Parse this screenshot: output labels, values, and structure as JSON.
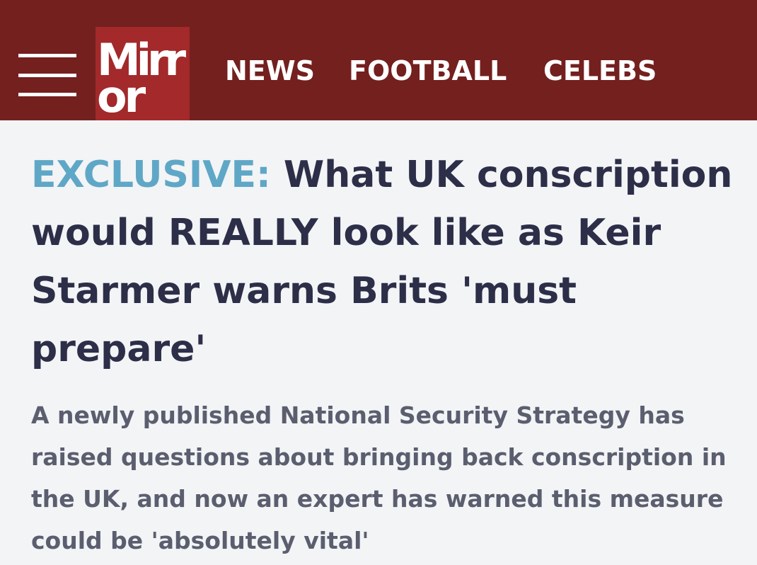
{
  "header": {
    "menu_icon": "hamburger-menu-icon",
    "logo": {
      "line1": "Mirr",
      "line2": "or"
    },
    "nav": [
      {
        "label": "NEWS"
      },
      {
        "label": "FOOTBALL"
      },
      {
        "label": "CELEBS"
      }
    ]
  },
  "article": {
    "kicker": "EXCLUSIVE:",
    "headline": "What UK conscription would REALLY look like as Keir Starmer warns Brits 'must prepare'",
    "standfirst": "A newly published National Security Strategy has raised questions about bringing back conscription in the UK, and now an expert has warned this measure could be 'absolutely vital'"
  },
  "colors": {
    "header_bg": "#73201f",
    "logo_bg": "#a3292a",
    "kicker": "#5fa7c6",
    "headline": "#2d2e48",
    "standfirst": "#5b5e6e",
    "page_bg": "#f3f4f6"
  }
}
